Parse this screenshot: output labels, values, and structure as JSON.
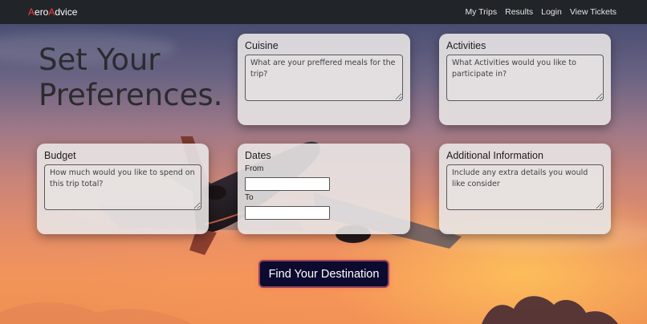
{
  "navbar": {
    "brand_a": "A",
    "brand_ero": "ero",
    "brand_a2": "A",
    "brand_dvice": "dvice",
    "links": [
      {
        "label": "My Trips"
      },
      {
        "label": "Results"
      },
      {
        "label": "Login"
      },
      {
        "label": "View Tickets"
      }
    ]
  },
  "hero": {
    "title": "Set Your\nPreferences."
  },
  "cards": {
    "cuisine": {
      "title": "Cuisine",
      "placeholder": "What are your preffered meals for the trip?"
    },
    "activities": {
      "title": "Activities",
      "placeholder": "What Activities would you like to participate in?"
    },
    "budget": {
      "title": "Budget",
      "placeholder": "How much would you like to spend on this trip total?"
    },
    "dates": {
      "title": "Dates",
      "from_label": "From",
      "to_label": "To"
    },
    "additional": {
      "title": "Additional Information",
      "placeholder": "Include any extra details you would like consider"
    }
  },
  "action": {
    "find_label": "Find Your Destination"
  },
  "colors": {
    "navbar_bg": "#212529",
    "brand_accent": "#ff3b3b",
    "button_bg": "#0c0a2e"
  }
}
